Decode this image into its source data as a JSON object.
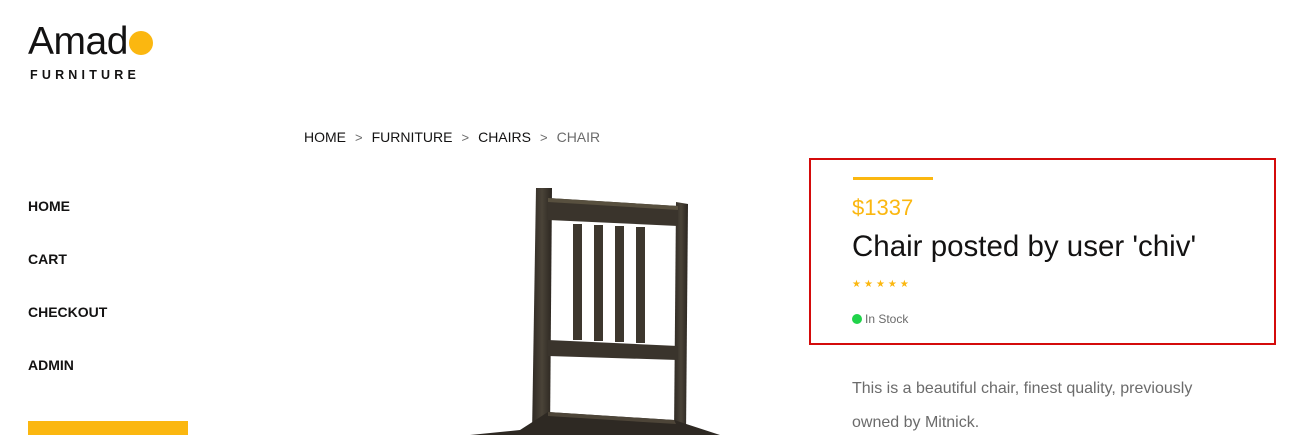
{
  "logo": {
    "word": "Amad",
    "sub": "FURNITURE"
  },
  "nav": {
    "items": [
      {
        "label": "HOME"
      },
      {
        "label": "CART"
      },
      {
        "label": "CHECKOUT"
      },
      {
        "label": "ADMIN"
      }
    ]
  },
  "breadcrumb": {
    "items": [
      {
        "label": "HOME"
      },
      {
        "label": "FURNITURE"
      },
      {
        "label": "CHAIRS"
      },
      {
        "label": "CHAIR"
      }
    ],
    "separator": ">"
  },
  "product": {
    "price": "$1337",
    "title": "Chair posted by user 'chiv'",
    "rating": 5,
    "stock": "In Stock",
    "description": "This is a beautiful chair, finest quality, previously owned by Mitnick."
  },
  "colors": {
    "accent": "#fbb710",
    "highlight_border": "#d40b0b",
    "in_stock": "#20d34a"
  },
  "icons": {
    "star": "star-icon",
    "stock": "stock-status-dot-icon"
  }
}
